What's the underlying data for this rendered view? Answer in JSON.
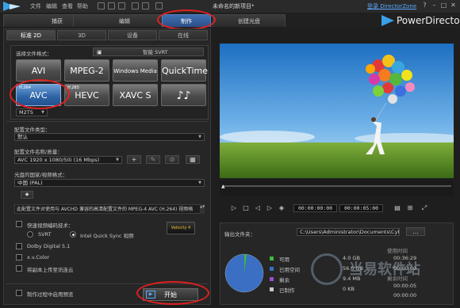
{
  "titlebar": {
    "menu": [
      "文件",
      "编辑",
      "查看",
      "帮助"
    ],
    "project_name": "未命名的新项目*",
    "login": "登录 DirectorZone",
    "window_controls": [
      "?",
      "–",
      "□",
      "✕"
    ]
  },
  "main_tabs": [
    "捕获",
    "编辑",
    "制作",
    "创建光盘"
  ],
  "active_main_tab": "制作",
  "brand": "PowerDirector",
  "sub_tabs": [
    "标准 2D",
    "3D",
    "设备",
    "在线"
  ],
  "format": {
    "section_label": "选择文件格式：",
    "svrt_label": "智能 SVRT",
    "buttons": [
      {
        "label": "AVI",
        "sup": ""
      },
      {
        "label": "MPEG-2",
        "sup": ""
      },
      {
        "label": "Windows Media",
        "sup": ""
      },
      {
        "label": "QuickTime",
        "sup": ""
      },
      {
        "label": "AVC",
        "sup": "H.264"
      },
      {
        "label": "HEVC",
        "sup": "H.265"
      },
      {
        "label": "XAVC S",
        "sup": ""
      },
      {
        "label": "♪♪",
        "sup": ""
      }
    ],
    "selected": "AVC",
    "container_value": "M2TS"
  },
  "profile_type": {
    "label": "配置文件类型：",
    "value": "默认"
  },
  "profile_name": {
    "label": "配置文件名称/质量：",
    "value": "AVC 1920 x 1080/50i (16 Mbps)"
  },
  "region": {
    "label": "光盘的国家/视频格式：",
    "value": "中国 (PAL)"
  },
  "description": "此配置文件对使用与 AVCHD 兼容的高清配置文件的 MPEG-4 AVC (H.264) 视频格",
  "options": {
    "fast_render": "快速视频编码技术：",
    "svrt": "SVRT",
    "intel": "Intel Quick Sync 视频",
    "dolby": "Dolby Digital 5.1",
    "xvcolor": "x.v.Color",
    "upload": "将副本上传至讯连云",
    "preview": "制作过程中启用预览",
    "velocity_badge": "Velocity 4"
  },
  "start_button": "开始",
  "playback": {
    "current_time": "00:00:00:00",
    "total_time": "00:00:05:00"
  },
  "output": {
    "folder_label": "输出文件夹：",
    "folder_path": "C:\\Users\\Administrator\\Documents\\CyberL",
    "browse": "...",
    "legend": [
      {
        "label": "可用",
        "value": "4.0 GB",
        "color": "#3dbb3d"
      },
      {
        "label": "已用空间",
        "value": "56.0 GB",
        "color": "#3a6fc4"
      },
      {
        "label": "剩余",
        "value": "9.4 MB",
        "color": "#9a4fc8"
      },
      {
        "label": "已制作",
        "value": "0 KB",
        "color": "#c9c9c9"
      }
    ],
    "time_headers": [
      "使用时间",
      "剩余时间"
    ],
    "times": [
      "00:36:29",
      "00:00:00",
      "00:00:05",
      "00:00:00"
    ]
  },
  "watermark": "当易软件站"
}
